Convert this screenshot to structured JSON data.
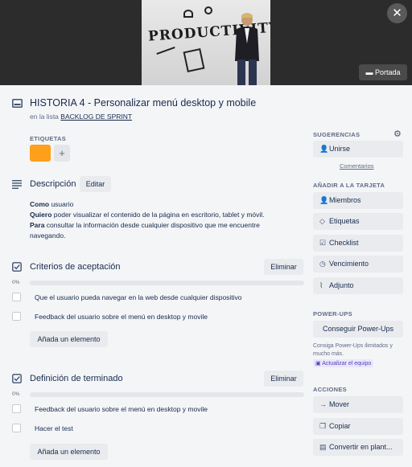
{
  "cover": {
    "word": "PRODUCTIVITY",
    "button_label": "Portada",
    "close_glyph": "✕",
    "icon": "card-image-icon"
  },
  "card": {
    "title": "HISTORIA 4 - Personalizar menú desktop y mobile",
    "list_prefix": "en la lista",
    "list_name": "BACKLOG DE SPRINT"
  },
  "labels": {
    "heading": "ETIQUETAS",
    "add": "+",
    "label_color": "#ff9f1a"
  },
  "description": {
    "heading": "Descripción",
    "edit_label": "Editar",
    "como_key": "Como",
    "como_val": " usuario",
    "quiero_key": "Quiero",
    "quiero_val": " poder visualizar el contenido de la página en escritorio, tablet y móvil.",
    "para_key": "Para",
    "para_val": " consultar la información desde cualquier dispositivo que me encuentre navegando."
  },
  "checklists": [
    {
      "title": "Criterios de aceptación",
      "delete_label": "Eliminar",
      "progress": "0%",
      "progress_value": 0,
      "items": [
        "Que el usuario pueda navegar en la web desde cualquier dispositivo",
        "Feedback del usuario sobre el menú en desktop y movile"
      ],
      "add_label": "Añada un elemento"
    },
    {
      "title": "Definición de terminado",
      "delete_label": "Eliminar",
      "progress": "0%",
      "progress_value": 0,
      "items": [
        "Feedback del usuario sobre el menú en desktop y movile",
        "Hacer el test"
      ],
      "add_label": "Añada un elemento"
    }
  ],
  "sidebar": {
    "suggestions_heading": "SUGERENCIAS",
    "join_label": "Unirse",
    "comments_label": "Comentarios",
    "add_heading": "AÑADIR A LA TARJETA",
    "add_items": [
      {
        "label": "Miembros",
        "icon": "user-icon",
        "glyph": "👤"
      },
      {
        "label": "Etiquetas",
        "icon": "tag-icon",
        "glyph": "◇"
      },
      {
        "label": "Checklist",
        "icon": "checklist-icon",
        "glyph": "☑"
      },
      {
        "label": "Vencimiento",
        "icon": "clock-icon",
        "glyph": "◷"
      },
      {
        "label": "Adjunto",
        "icon": "paperclip-icon",
        "glyph": "⌇"
      }
    ],
    "powerups_heading": "POWER-UPS",
    "powerups_button": "Conseguir Power-Ups",
    "powerups_desc": "Consiga Power-Ups ilimitados y mucho más.",
    "upgrade_label": "Actualizar el equipo",
    "actions_heading": "ACCIONES",
    "actions": [
      {
        "label": "Mover",
        "icon": "arrow-right-icon",
        "glyph": "→"
      },
      {
        "label": "Copiar",
        "icon": "copy-icon",
        "glyph": "❐"
      },
      {
        "label": "Convertir en plant...",
        "icon": "template-icon",
        "glyph": "▤"
      }
    ]
  }
}
